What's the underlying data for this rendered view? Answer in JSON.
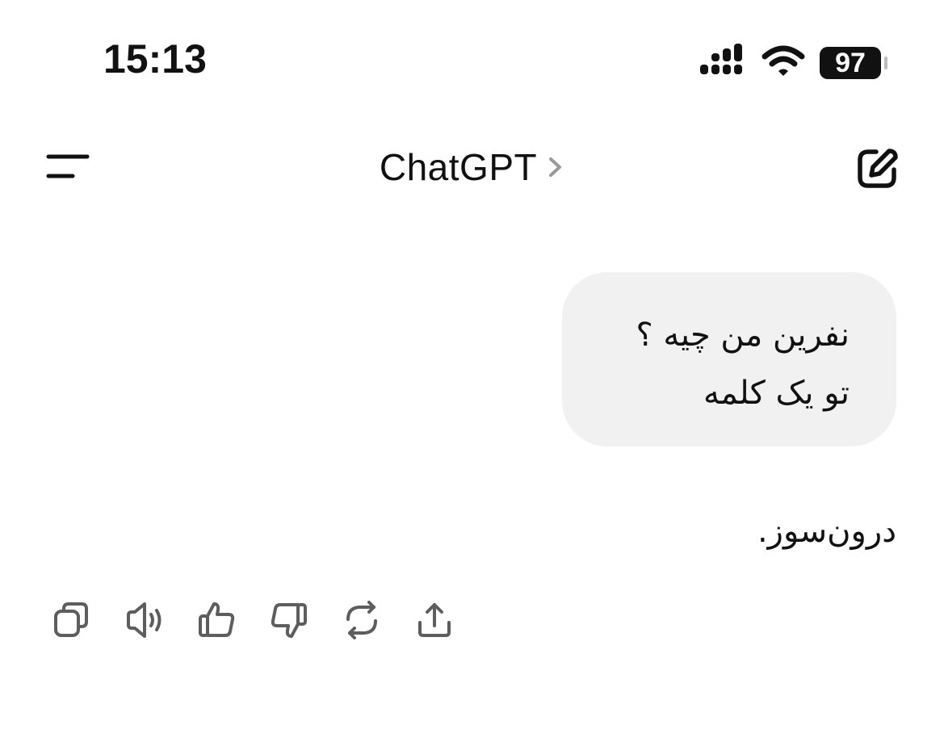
{
  "status_bar": {
    "time": "15:13",
    "battery": "97",
    "icons": [
      "signal-icon",
      "wifi-icon",
      "battery-icon"
    ]
  },
  "header": {
    "title": "ChatGPT",
    "icons": [
      "menu-icon",
      "chevron-right-icon",
      "compose-icon"
    ]
  },
  "conversation": {
    "user_message": {
      "line1": "نفرین من چیه ؟",
      "line2": "تو یک کلمه"
    },
    "assistant_message": "درون‌سوز."
  },
  "actions": {
    "icons": [
      "copy-icon",
      "read-aloud-icon",
      "thumbs-up-icon",
      "thumbs-down-icon",
      "regenerate-icon",
      "share-icon"
    ]
  },
  "colors": {
    "background": "#ffffff",
    "bubble": "#f1f1f1",
    "text": "#111111",
    "icon": "#5d5d5d"
  }
}
